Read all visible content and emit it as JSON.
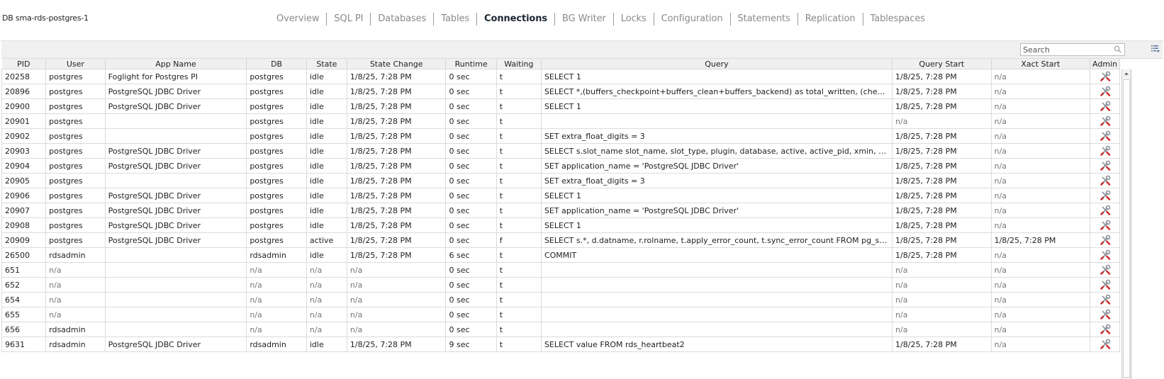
{
  "header": {
    "title": "DB sma-rds-postgres-1",
    "tabs": [
      {
        "label": "Overview",
        "active": false
      },
      {
        "label": "SQL PI",
        "active": false
      },
      {
        "label": "Databases",
        "active": false
      },
      {
        "label": "Tables",
        "active": false
      },
      {
        "label": "Connections",
        "active": true
      },
      {
        "label": "BG Writer",
        "active": false
      },
      {
        "label": "Locks",
        "active": false
      },
      {
        "label": "Configuration",
        "active": false
      },
      {
        "label": "Statements",
        "active": false
      },
      {
        "label": "Replication",
        "active": false
      },
      {
        "label": "Tablespaces",
        "active": false
      }
    ]
  },
  "toolbar": {
    "search_placeholder": "Search",
    "search_value": "",
    "search_icon": "magnifier-icon",
    "columns_menu_icon": "column-chooser-icon"
  },
  "table": {
    "columns": [
      "PID",
      "User",
      "App Name",
      "DB",
      "State",
      "State Change",
      "Runtime",
      "Waiting",
      "Query",
      "Query Start",
      "Xact Start",
      "Admin"
    ],
    "admin_icon": "wrench-screwdriver-icon",
    "rows": [
      {
        "pid": "20258",
        "user": "postgres",
        "app": "Foglight for Postgres PI",
        "db": "postgres",
        "state": "idle",
        "state_change": "1/8/25, 7:28 PM",
        "runtime": "0 sec",
        "waiting": "t",
        "query": "SELECT 1",
        "query_start": "1/8/25, 7:28 PM",
        "xact_start": "n/a"
      },
      {
        "pid": "20896",
        "user": "postgres",
        "app": "PostgreSQL JDBC Driver",
        "db": "postgres",
        "state": "idle",
        "state_change": "1/8/25, 7:28 PM",
        "runtime": "0 sec",
        "waiting": "t",
        "query": "SELECT *,(buffers_checkpoint+buffers_clean+buffers_backend) as total_written, (checkpoints_timed+c...",
        "query_start": "1/8/25, 7:28 PM",
        "xact_start": "n/a"
      },
      {
        "pid": "20900",
        "user": "postgres",
        "app": "PostgreSQL JDBC Driver",
        "db": "postgres",
        "state": "idle",
        "state_change": "1/8/25, 7:28 PM",
        "runtime": "0 sec",
        "waiting": "t",
        "query": "SELECT 1",
        "query_start": "1/8/25, 7:28 PM",
        "xact_start": "n/a"
      },
      {
        "pid": "20901",
        "user": "postgres",
        "app": "",
        "db": "postgres",
        "state": "idle",
        "state_change": "1/8/25, 7:28 PM",
        "runtime": "0 sec",
        "waiting": "t",
        "query": "",
        "query_start": "n/a",
        "xact_start": "n/a"
      },
      {
        "pid": "20902",
        "user": "postgres",
        "app": "",
        "db": "postgres",
        "state": "idle",
        "state_change": "1/8/25, 7:28 PM",
        "runtime": "0 sec",
        "waiting": "t",
        "query": "SET extra_float_digits = 3",
        "query_start": "1/8/25, 7:28 PM",
        "xact_start": "n/a"
      },
      {
        "pid": "20903",
        "user": "postgres",
        "app": "PostgreSQL JDBC Driver",
        "db": "postgres",
        "state": "idle",
        "state_change": "1/8/25, 7:28 PM",
        "runtime": "0 sec",
        "waiting": "t",
        "query": "SELECT s.slot_name slot_name, slot_type, plugin, database, active, active_pid, xmin, catalog_xmin, rest...",
        "query_start": "1/8/25, 7:28 PM",
        "xact_start": "n/a"
      },
      {
        "pid": "20904",
        "user": "postgres",
        "app": "PostgreSQL JDBC Driver",
        "db": "postgres",
        "state": "idle",
        "state_change": "1/8/25, 7:28 PM",
        "runtime": "0 sec",
        "waiting": "t",
        "query": "SET application_name = 'PostgreSQL JDBC Driver'",
        "query_start": "1/8/25, 7:28 PM",
        "xact_start": "n/a"
      },
      {
        "pid": "20905",
        "user": "postgres",
        "app": "",
        "db": "postgres",
        "state": "idle",
        "state_change": "1/8/25, 7:28 PM",
        "runtime": "0 sec",
        "waiting": "t",
        "query": "SET extra_float_digits = 3",
        "query_start": "1/8/25, 7:28 PM",
        "xact_start": "n/a"
      },
      {
        "pid": "20906",
        "user": "postgres",
        "app": "PostgreSQL JDBC Driver",
        "db": "postgres",
        "state": "idle",
        "state_change": "1/8/25, 7:28 PM",
        "runtime": "0 sec",
        "waiting": "t",
        "query": "SELECT 1",
        "query_start": "1/8/25, 7:28 PM",
        "xact_start": "n/a"
      },
      {
        "pid": "20907",
        "user": "postgres",
        "app": "PostgreSQL JDBC Driver",
        "db": "postgres",
        "state": "idle",
        "state_change": "1/8/25, 7:28 PM",
        "runtime": "0 sec",
        "waiting": "t",
        "query": "SET application_name = 'PostgreSQL JDBC Driver'",
        "query_start": "1/8/25, 7:28 PM",
        "xact_start": "n/a"
      },
      {
        "pid": "20908",
        "user": "postgres",
        "app": "PostgreSQL JDBC Driver",
        "db": "postgres",
        "state": "idle",
        "state_change": "1/8/25, 7:28 PM",
        "runtime": "0 sec",
        "waiting": "t",
        "query": "SELECT 1",
        "query_start": "1/8/25, 7:28 PM",
        "xact_start": "n/a"
      },
      {
        "pid": "20909",
        "user": "postgres",
        "app": "PostgreSQL JDBC Driver",
        "db": "postgres",
        "state": "active",
        "state_change": "1/8/25, 7:28 PM",
        "runtime": "0 sec",
        "waiting": "f",
        "query": "SELECT s.*, d.datname, r.rolname, t.apply_error_count, t.sync_error_count FROM pg_subscription s LEF...",
        "query_start": "1/8/25, 7:28 PM",
        "xact_start": "1/8/25, 7:28 PM"
      },
      {
        "pid": "26500",
        "user": "rdsadmin",
        "app": "",
        "db": "rdsadmin",
        "state": "idle",
        "state_change": "1/8/25, 7:28 PM",
        "runtime": "6 sec",
        "waiting": "t",
        "query": "COMMIT",
        "query_start": "1/8/25, 7:28 PM",
        "xact_start": "n/a"
      },
      {
        "pid": "651",
        "user": "n/a",
        "app": "",
        "db": "n/a",
        "state": "n/a",
        "state_change": "n/a",
        "runtime": "0 sec",
        "waiting": "t",
        "query": "",
        "query_start": "n/a",
        "xact_start": "n/a"
      },
      {
        "pid": "652",
        "user": "n/a",
        "app": "",
        "db": "n/a",
        "state": "n/a",
        "state_change": "n/a",
        "runtime": "0 sec",
        "waiting": "t",
        "query": "",
        "query_start": "n/a",
        "xact_start": "n/a"
      },
      {
        "pid": "654",
        "user": "n/a",
        "app": "",
        "db": "n/a",
        "state": "n/a",
        "state_change": "n/a",
        "runtime": "0 sec",
        "waiting": "t",
        "query": "",
        "query_start": "n/a",
        "xact_start": "n/a"
      },
      {
        "pid": "655",
        "user": "n/a",
        "app": "",
        "db": "n/a",
        "state": "n/a",
        "state_change": "n/a",
        "runtime": "0 sec",
        "waiting": "t",
        "query": "",
        "query_start": "n/a",
        "xact_start": "n/a"
      },
      {
        "pid": "656",
        "user": "rdsadmin",
        "app": "",
        "db": "n/a",
        "state": "n/a",
        "state_change": "n/a",
        "runtime": "0 sec",
        "waiting": "t",
        "query": "",
        "query_start": "n/a",
        "xact_start": "n/a"
      },
      {
        "pid": "9631",
        "user": "rdsadmin",
        "app": "PostgreSQL JDBC Driver",
        "db": "rdsadmin",
        "state": "idle",
        "state_change": "1/8/25, 7:28 PM",
        "runtime": "9 sec",
        "waiting": "t",
        "query": "SELECT value FROM rds_heartbeat2",
        "query_start": "1/8/25, 7:28 PM",
        "xact_start": "n/a"
      }
    ]
  }
}
